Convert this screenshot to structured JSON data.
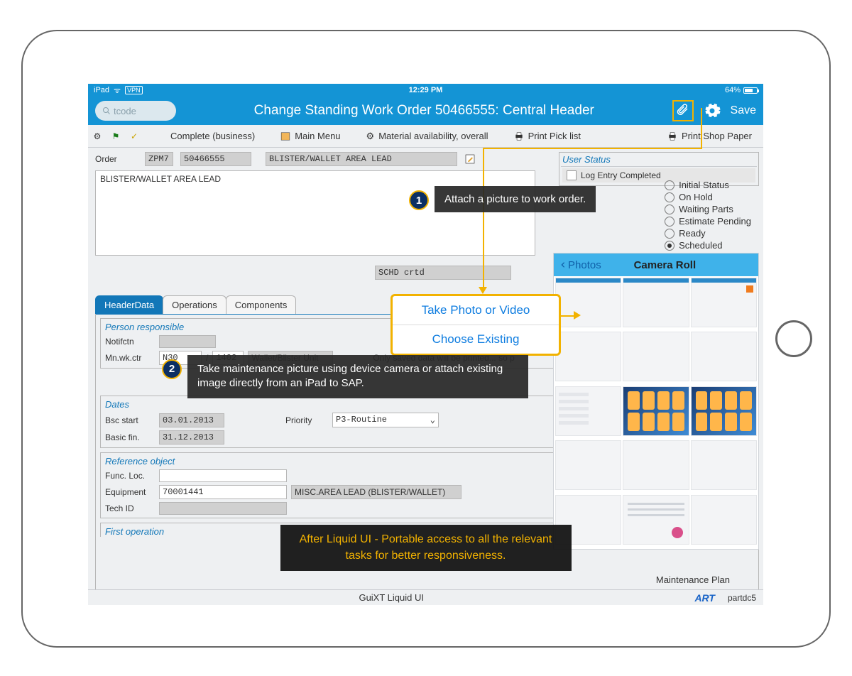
{
  "statusbar": {
    "device": "iPad",
    "wifi": "᯾",
    "vpn": "VPN",
    "time": "12:29 PM",
    "battery_text": "64%"
  },
  "titlebar": {
    "search_placeholder": "tcode",
    "title": "Change Standing Work Order 50466555: Central Header",
    "save": "Save"
  },
  "toolbar": {
    "complete": "Complete (business)",
    "main_menu": "Main Menu",
    "material": "Material availability, overall",
    "pick_list": "Print Pick list",
    "shop_paper": "Print Shop Paper"
  },
  "order": {
    "label": "Order",
    "type": "ZPM7",
    "number": "50466555",
    "desc": "BLISTER/WALLET AREA LEAD",
    "memo": "BLISTER/WALLET AREA LEAD"
  },
  "user_status": {
    "header": "User Status",
    "log_entry": "Log Entry Completed",
    "options": [
      "Initial Status",
      "On Hold",
      "Waiting Parts",
      "Estimate Pending",
      "Ready",
      "Scheduled"
    ],
    "selected": "Scheduled"
  },
  "status_field": "SCHD crtd",
  "tabs": [
    "HeaderData",
    "Operations",
    "Components"
  ],
  "active_tab": "HeaderData",
  "person_responsible": {
    "header": "Person responsible",
    "notifctn_label": "Notifctn",
    "mnwk_label": "Mn.wk.ctr",
    "mnwk1": "N30",
    "mnwk_sep": "/",
    "mnwk2": "1402",
    "mnwk_desc": "Wallet/Blister Unit",
    "note": "Only saved data will be printed... so p"
  },
  "dates": {
    "header": "Dates",
    "bsc_label": "Bsc start",
    "bsc_val": "03.01.2013",
    "fin_label": "Basic fin.",
    "fin_val": "31.12.2013",
    "prio_label": "Priority",
    "prio_val": "P3-Routine"
  },
  "reference": {
    "header": "Reference object",
    "func_label": "Func. Loc.",
    "equip_label": "Equipment",
    "equip_val": "70001441",
    "equip_desc": "MISC.AREA LEAD (BLISTER/WALLET)",
    "tech_label": "Tech ID"
  },
  "first_op": {
    "header": "First operation"
  },
  "photo_popup": {
    "take": "Take Photo or Video",
    "choose": "Choose Existing"
  },
  "camera_roll": {
    "back": "Photos",
    "title": "Camera Roll"
  },
  "callouts": {
    "one": "Attach a picture to work order.",
    "two": "Take maintenance picture using device camera or attach existing image directly from an iPad to SAP.",
    "footer": "After Liquid UI - Portable access to all the relevant tasks for better responsiveness."
  },
  "bottom": {
    "mid": "GuiXT Liquid UI",
    "art": "ART",
    "sys": "partdc5",
    "maint": "Maintenance Plan"
  }
}
